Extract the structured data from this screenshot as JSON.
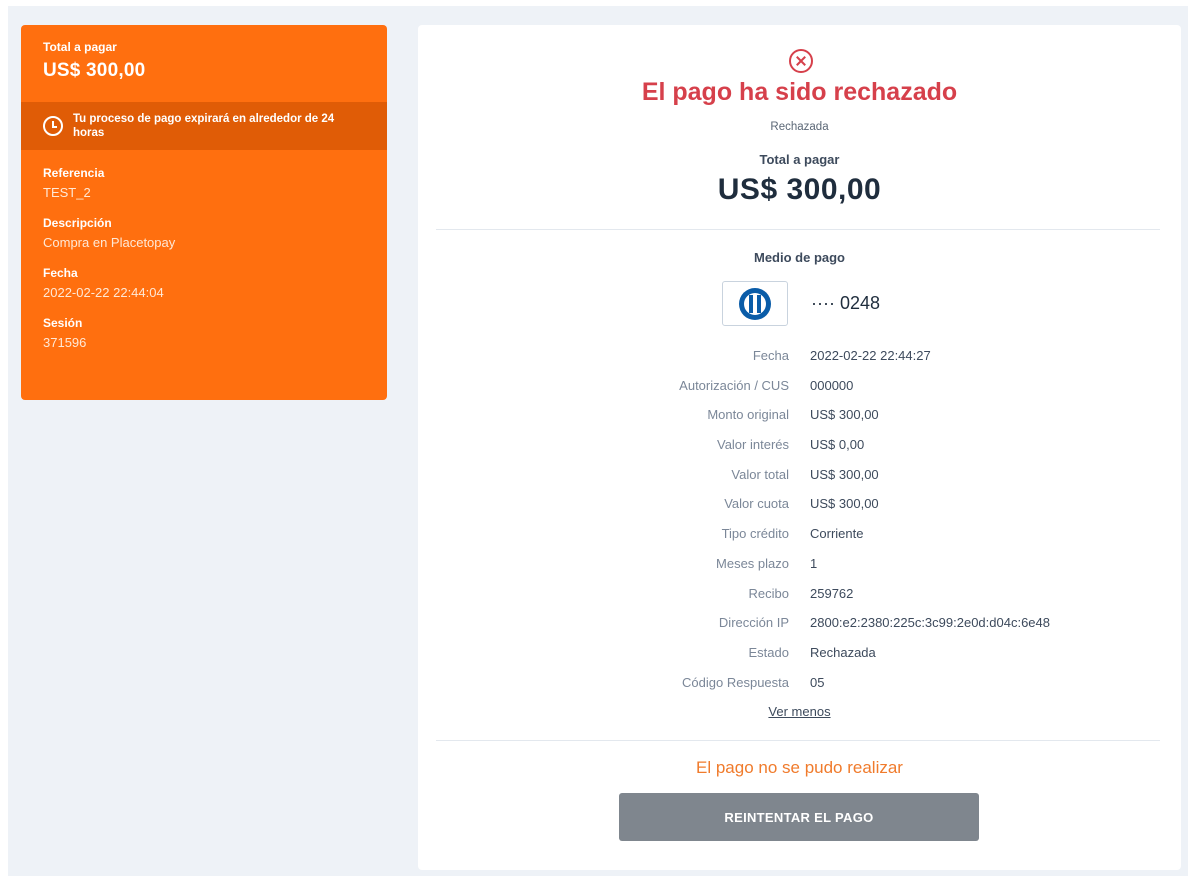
{
  "sidebar": {
    "total_label": "Total a pagar",
    "total_amount": "US$ 300,00",
    "expire_icon": "clock-icon",
    "expire_text": "Tu proceso de pago expirará en alrededor de 24 horas",
    "fields": [
      {
        "label": "Referencia",
        "value": "TEST_2"
      },
      {
        "label": "Descripción",
        "value": "Compra en Placetopay"
      },
      {
        "label": "Fecha",
        "value": "2022-02-22 22:44:04"
      },
      {
        "label": "Sesión",
        "value": "371596"
      }
    ],
    "color": "#ff6f0f"
  },
  "main": {
    "status_icon": "error-circle-icon",
    "title": "El pago ha sido rechazado",
    "subtitle": "Rechazada",
    "total_label": "Total a pagar",
    "total_amount": "US$ 300,00",
    "payment_method_label": "Medio de pago",
    "card_brand_icon": "diners-club-icon",
    "card_number": "···· 0248",
    "details": [
      {
        "label": "Fecha",
        "value": "2022-02-22 22:44:27"
      },
      {
        "label": "Autorización / CUS",
        "value": "000000"
      },
      {
        "label": "Monto original",
        "value": "US$ 300,00"
      },
      {
        "label": "Valor interés",
        "value": "US$ 0,00"
      },
      {
        "label": "Valor total",
        "value": "US$ 300,00"
      },
      {
        "label": "Valor cuota",
        "value": "US$ 300,00"
      },
      {
        "label": "Tipo crédito",
        "value": "Corriente"
      },
      {
        "label": "Meses plazo",
        "value": "1"
      },
      {
        "label": "Recibo",
        "value": "259762"
      },
      {
        "label": "Dirección IP",
        "value": "2800:e2:2380:225c:3c99:2e0d:d04c:6e48"
      },
      {
        "label": "Estado",
        "value": "Rechazada"
      },
      {
        "label": "Código Respuesta",
        "value": "05"
      }
    ],
    "toggle_label": "Ver menos",
    "fail_message": "El pago no se pudo realizar",
    "retry_label": "REINTENTAR EL PAGO",
    "colors": {
      "error": "#d6404b",
      "warning": "#f07b2c",
      "button": "#7f868e"
    }
  }
}
